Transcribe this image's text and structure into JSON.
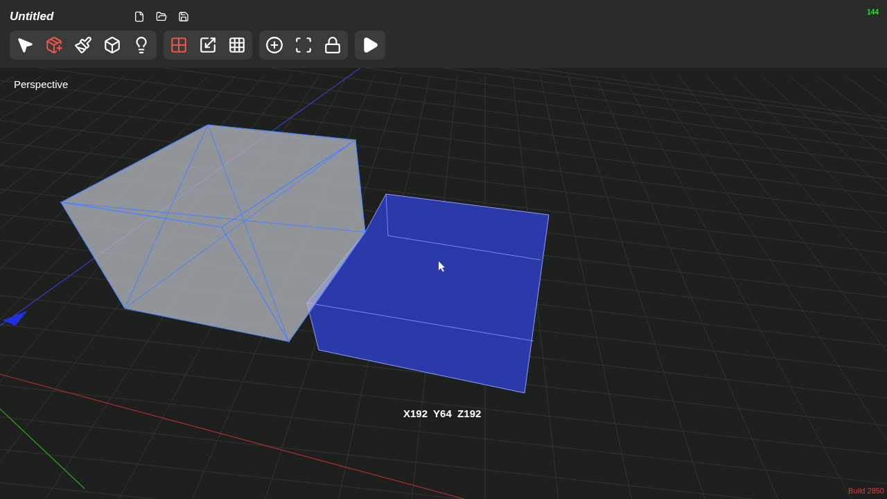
{
  "window": {
    "title": "Untitled"
  },
  "file_actions": [
    {
      "kind": "new"
    },
    {
      "kind": "open"
    },
    {
      "kind": "save"
    }
  ],
  "toolbar_groups": [
    {
      "tools": [
        {
          "kind": "select",
          "selected": false
        },
        {
          "kind": "add-box",
          "selected": true
        },
        {
          "kind": "paint",
          "selected": false
        },
        {
          "kind": "wireframe",
          "selected": false
        },
        {
          "kind": "light",
          "selected": false
        }
      ]
    },
    {
      "tools": [
        {
          "kind": "quad-view",
          "selected": true
        },
        {
          "kind": "single-view",
          "selected": false
        },
        {
          "kind": "grid-snap",
          "selected": false
        }
      ]
    },
    {
      "tools": [
        {
          "kind": "add-sphere",
          "selected": false
        },
        {
          "kind": "focus",
          "selected": false
        },
        {
          "kind": "texture-lock",
          "selected": false
        }
      ]
    },
    {
      "tools": [
        {
          "kind": "play",
          "selected": false
        }
      ]
    }
  ],
  "viewport": {
    "label": "Perspective",
    "dimensions": "X192  Y64  Z192",
    "fps": "144",
    "build": "Build 2850"
  }
}
